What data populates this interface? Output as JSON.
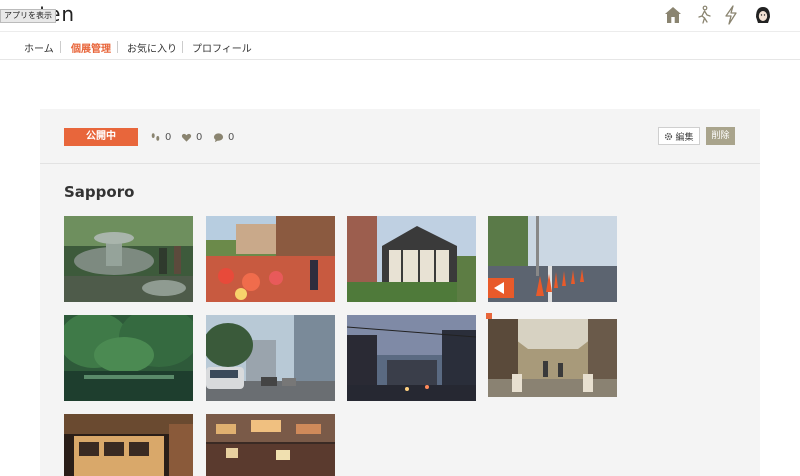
{
  "header": {
    "logo_text": "aten",
    "app_tooltip": "アプリを表示",
    "icons": [
      "home-icon",
      "walk-icon",
      "lightning-icon",
      "user-avatar"
    ]
  },
  "nav": {
    "items": [
      {
        "label": "ホーム",
        "active": false
      },
      {
        "label": "個展管理",
        "active": true
      },
      {
        "label": "お気に入り",
        "active": false
      },
      {
        "label": "プロフィール",
        "active": false
      }
    ]
  },
  "exhibit": {
    "status": "公開中",
    "footsteps": "0",
    "likes": "0",
    "comments": "0",
    "edit_label": "編集",
    "delete_label": "削除",
    "title": "Sapporo"
  },
  "colors": {
    "accent": "#e8663b",
    "delete": "#a9a48c",
    "panel": "#f4f4f4"
  },
  "photos": [
    {
      "name": "photo-fountain"
    },
    {
      "name": "photo-garden-flowers"
    },
    {
      "name": "photo-tudor-building"
    },
    {
      "name": "photo-traffic-cones"
    },
    {
      "name": "photo-forest-pond"
    },
    {
      "name": "photo-city-street"
    },
    {
      "name": "photo-dusk-street"
    },
    {
      "name": "photo-shopping-arcade"
    },
    {
      "name": "photo-night-tram"
    },
    {
      "name": "photo-night-alley"
    }
  ]
}
